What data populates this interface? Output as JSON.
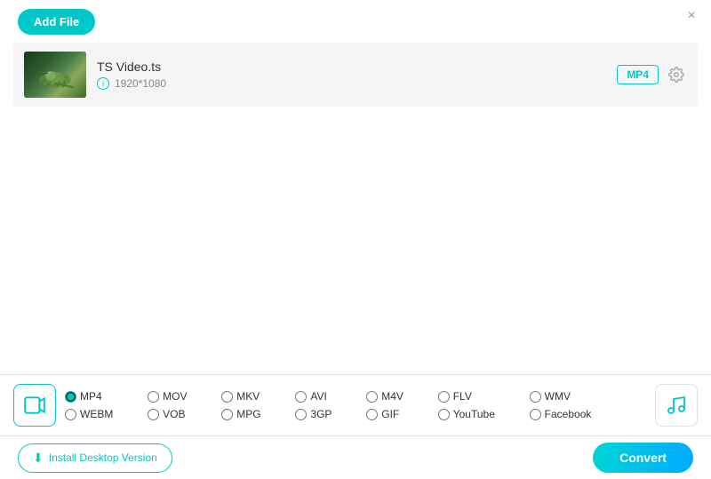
{
  "titleBar": {
    "closeLabel": "×"
  },
  "addFileButton": {
    "label": "Add File"
  },
  "fileItem": {
    "name": "TS Video.ts",
    "resolution": "1920*1080",
    "format": "MP4"
  },
  "formatSelector": {
    "videoIconLabel": "video-format-icon",
    "musicIconLabel": "music-format-icon",
    "formats": [
      {
        "id": "mp4",
        "label": "MP4",
        "row": 0,
        "selected": true
      },
      {
        "id": "mov",
        "label": "MOV",
        "row": 0,
        "selected": false
      },
      {
        "id": "mkv",
        "label": "MKV",
        "row": 0,
        "selected": false
      },
      {
        "id": "avi",
        "label": "AVI",
        "row": 0,
        "selected": false
      },
      {
        "id": "m4v",
        "label": "M4V",
        "row": 0,
        "selected": false
      },
      {
        "id": "flv",
        "label": "FLV",
        "row": 0,
        "selected": false
      },
      {
        "id": "wmv",
        "label": "WMV",
        "row": 0,
        "selected": false
      },
      {
        "id": "webm",
        "label": "WEBM",
        "row": 1,
        "selected": false
      },
      {
        "id": "vob",
        "label": "VOB",
        "row": 1,
        "selected": false
      },
      {
        "id": "mpg",
        "label": "MPG",
        "row": 1,
        "selected": false
      },
      {
        "id": "3gp",
        "label": "3GP",
        "row": 1,
        "selected": false
      },
      {
        "id": "gif",
        "label": "GIF",
        "row": 1,
        "selected": false
      },
      {
        "id": "youtube",
        "label": "YouTube",
        "row": 1,
        "selected": false
      },
      {
        "id": "facebook",
        "label": "Facebook",
        "row": 1,
        "selected": false
      }
    ]
  },
  "footer": {
    "installLabel": "Install Desktop Version",
    "convertLabel": "Convert"
  }
}
